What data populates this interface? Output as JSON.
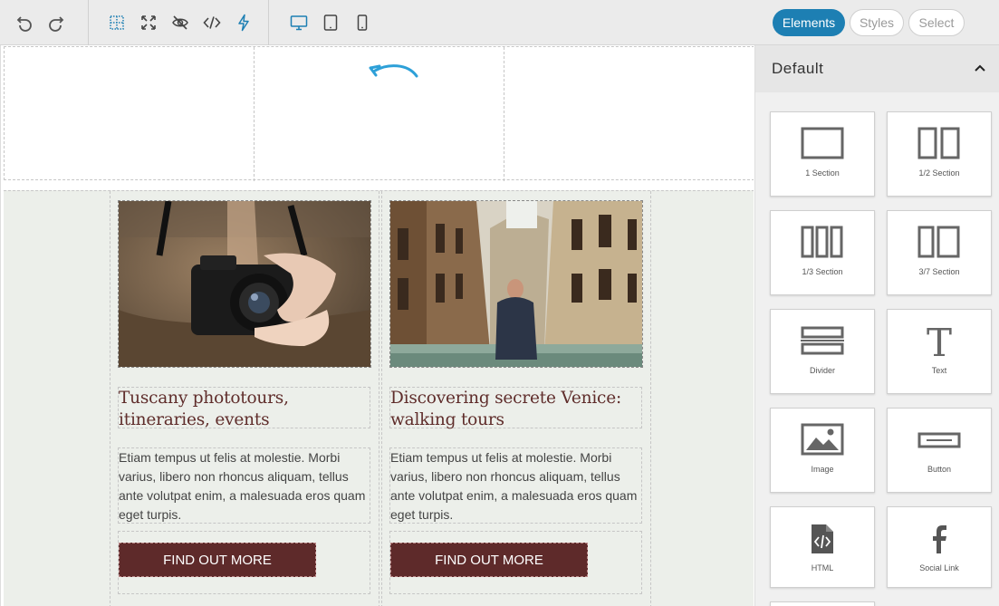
{
  "toolbar": {
    "tabs": {
      "elements": "Elements",
      "styles": "Styles",
      "select": "Select"
    }
  },
  "canvas": {
    "cards": [
      {
        "title": "Tuscany phototours, itineraries, events",
        "body": "Etiam tempus ut felis at molestie. Morbi varius, libero non rhoncus aliquam, tellus ante volutpat enim, a malesuada eros quam eget turpis.",
        "button": "FIND OUT MORE"
      },
      {
        "title": "Discovering secrete Venice: walking tours",
        "body": "Etiam tempus ut felis at molestie. Morbi varius, libero non rhoncus aliquam, tellus ante volutpat enim, a malesuada eros quam eget turpis.",
        "button": "FIND OUT MORE"
      }
    ]
  },
  "sidebar": {
    "section_title": "Default",
    "blocks": [
      {
        "label": "1 Section",
        "icon": "one-section-icon"
      },
      {
        "label": "1/2 Section",
        "icon": "half-section-icon"
      },
      {
        "label": "1/3 Section",
        "icon": "third-section-icon"
      },
      {
        "label": "3/7 Section",
        "icon": "three-seven-section-icon"
      },
      {
        "label": "Divider",
        "icon": "divider-icon"
      },
      {
        "label": "Text",
        "icon": "text-icon"
      },
      {
        "label": "Image",
        "icon": "image-icon"
      },
      {
        "label": "Button",
        "icon": "button-icon"
      },
      {
        "label": "HTML",
        "icon": "html-icon"
      },
      {
        "label": "Social Link",
        "icon": "social-link-icon"
      }
    ]
  },
  "colors": {
    "accent": "#1d7fb3",
    "button": "#5e2a2a",
    "title": "#5f2d2b",
    "canvas_bg": "#ecefea"
  }
}
